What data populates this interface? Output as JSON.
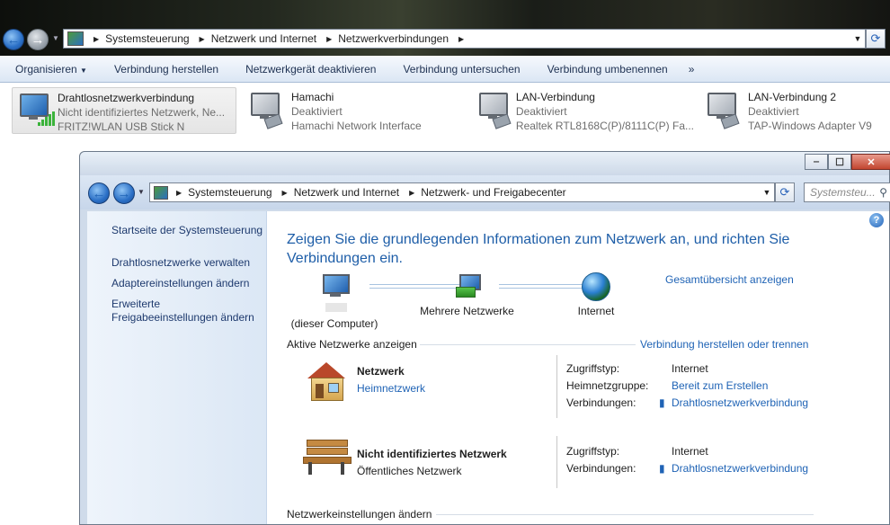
{
  "back_window": {
    "address": [
      "Systemsteuerung",
      "Netzwerk und Internet",
      "Netzwerkverbindungen"
    ],
    "toolbar": [
      "Organisieren",
      "Verbindung herstellen",
      "Netzwerkgerät deaktivieren",
      "Verbindung untersuchen",
      "Verbindung umbenennen",
      "»"
    ],
    "organize_arrow": "▼",
    "connections": [
      {
        "name": "Drahtlosnetzwerkverbindung",
        "status": "Nicht identifiziertes Netzwerk, Ne...",
        "device": "FRITZ!WLAN USB Stick N",
        "icon": "wireless-adapter-icon"
      },
      {
        "name": "Hamachi",
        "status": "Deaktiviert",
        "device": "Hamachi Network Interface",
        "icon": "network-adapter-icon"
      },
      {
        "name": "LAN-Verbindung",
        "status": "Deaktiviert",
        "device": "Realtek RTL8168C(P)/8111C(P) Fa...",
        "icon": "network-adapter-icon"
      },
      {
        "name": "LAN-Verbindung 2",
        "status": "Deaktiviert",
        "device": "TAP-Windows Adapter V9",
        "icon": "network-adapter-icon"
      }
    ]
  },
  "front_window": {
    "address": [
      "Systemsteuerung",
      "Netzwerk und Internet",
      "Netzwerk- und Freigabecenter"
    ],
    "search_placeholder": "Systemsteu...",
    "caption_buttons": {
      "minimize": "‒",
      "maximize": "☐",
      "close": "✕"
    },
    "sidebar": [
      "Startseite der Systemsteuerung",
      "Drahtlosnetzwerke verwalten",
      "Adaptereinstellungen ändern",
      "Erweiterte Freigabeeinstellungen ändern"
    ],
    "heading": "Zeigen Sie die grundlegenden Informationen zum Netzwerk an, und richten Sie Verbindungen ein.",
    "map": {
      "computer_label": "(dieser Computer)",
      "networks_label": "Mehrere Netzwerke",
      "internet_label": "Internet",
      "overview_link": "Gesamtübersicht anzeigen"
    },
    "active_section": {
      "title": "Aktive Netzwerke anzeigen",
      "link": "Verbindung herstellen oder trennen"
    },
    "networks": [
      {
        "name": "Netzwerk",
        "type": "Heimnetzwerk",
        "icon": "home-network-icon",
        "rows": [
          {
            "key": "Zugriffstyp:",
            "value": "Internet"
          },
          {
            "key": "Heimnetzgruppe:",
            "value": "Bereit zum Erstellen"
          },
          {
            "key": "Verbindungen:",
            "value": "Drahtlosnetzwerkverbindung"
          }
        ]
      },
      {
        "name": "Nicht identifiziertes Netzwerk",
        "type": "Öffentliches Netzwerk",
        "icon": "public-network-bench-icon",
        "rows": [
          {
            "key": "Zugriffstyp:",
            "value": "Internet"
          },
          {
            "key": "Verbindungen:",
            "value": "Drahtlosnetzwerkverbindung"
          }
        ]
      }
    ],
    "change_settings": "Netzwerkeinstellungen ändern"
  }
}
